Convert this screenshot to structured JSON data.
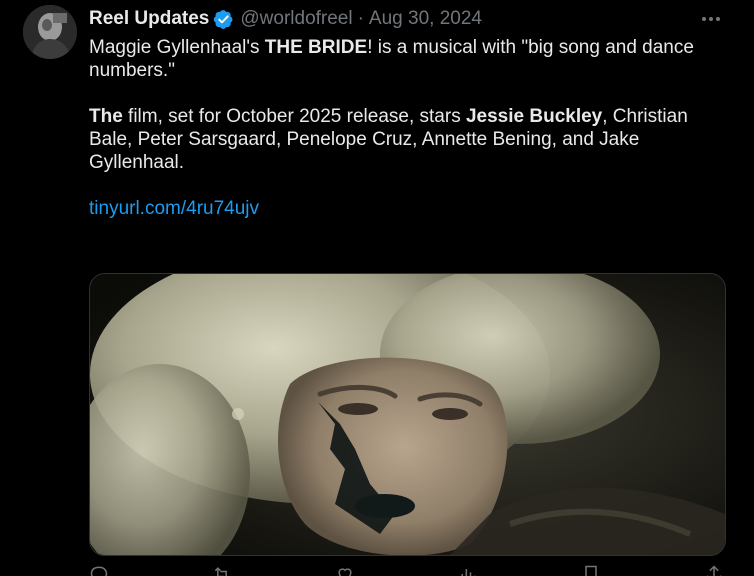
{
  "author": {
    "display_name": "Reel Updates",
    "handle": "@worldofreel",
    "separator": "·",
    "date": "Aug 30, 2024",
    "verified_icon": "verified-badge-icon",
    "accent_color": "#1d9bf0"
  },
  "tweet": {
    "p1_a": "Maggie Gyllenhaal's ",
    "p1_b": "THE BRIDE",
    "p1_c": "! is a musical with \"big song and dance numbers.\"",
    "p2_a": "The",
    "p2_b": " film, set for October 2025 release, stars ",
    "p2_c": "Jessie Buckley",
    "p2_d": ", Christian Bale, Peter Sarsgaard, Penelope Cruz, Annette Bening, and Jake Gyllenhaal.",
    "link": "tinyurl.com/4ru74ujv"
  },
  "icons": {
    "more": "more-options-icon",
    "reply": "reply-icon",
    "retweet": "retweet-icon",
    "like": "like-icon",
    "views": "views-icon",
    "bookmark": "bookmark-icon",
    "share": "share-icon"
  },
  "colors": {
    "background": "#000000",
    "text": "#e7e9ea",
    "secondary_text": "#71767b",
    "link": "#1d9bf0"
  }
}
